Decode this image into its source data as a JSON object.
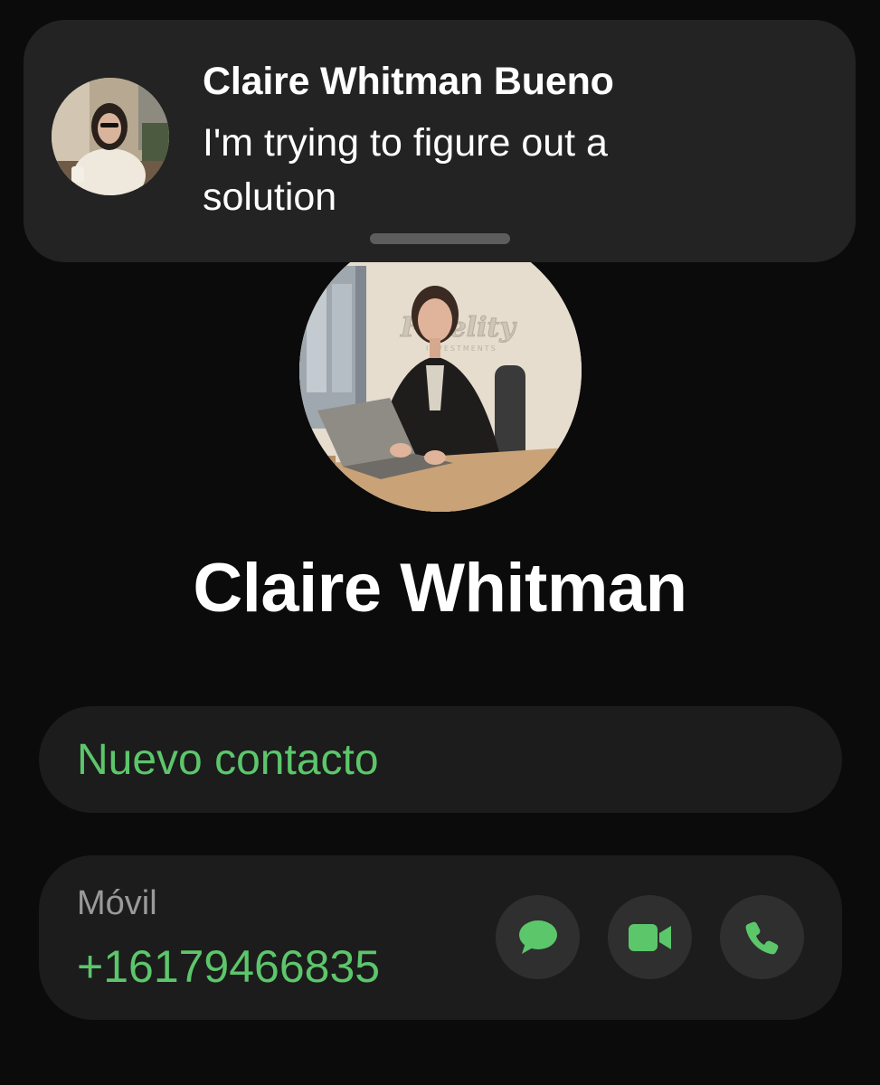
{
  "notification": {
    "sender": "Claire Whitman Bueno",
    "message": "I'm trying to figure out a solution"
  },
  "contact": {
    "name": "Claire Whitman",
    "new_contact_label": "Nuevo contacto",
    "phone_type": "Móvil",
    "phone_number": "+16179466835"
  },
  "actions": [
    {
      "icon": "message-bubble-icon"
    },
    {
      "icon": "video-camera-icon"
    },
    {
      "icon": "phone-icon"
    }
  ],
  "colors": {
    "accent_green": "#5cc66b",
    "background": "#0b0b0b",
    "card": "#1c1c1c",
    "banner": "#232323",
    "button": "#2f2f2f"
  }
}
